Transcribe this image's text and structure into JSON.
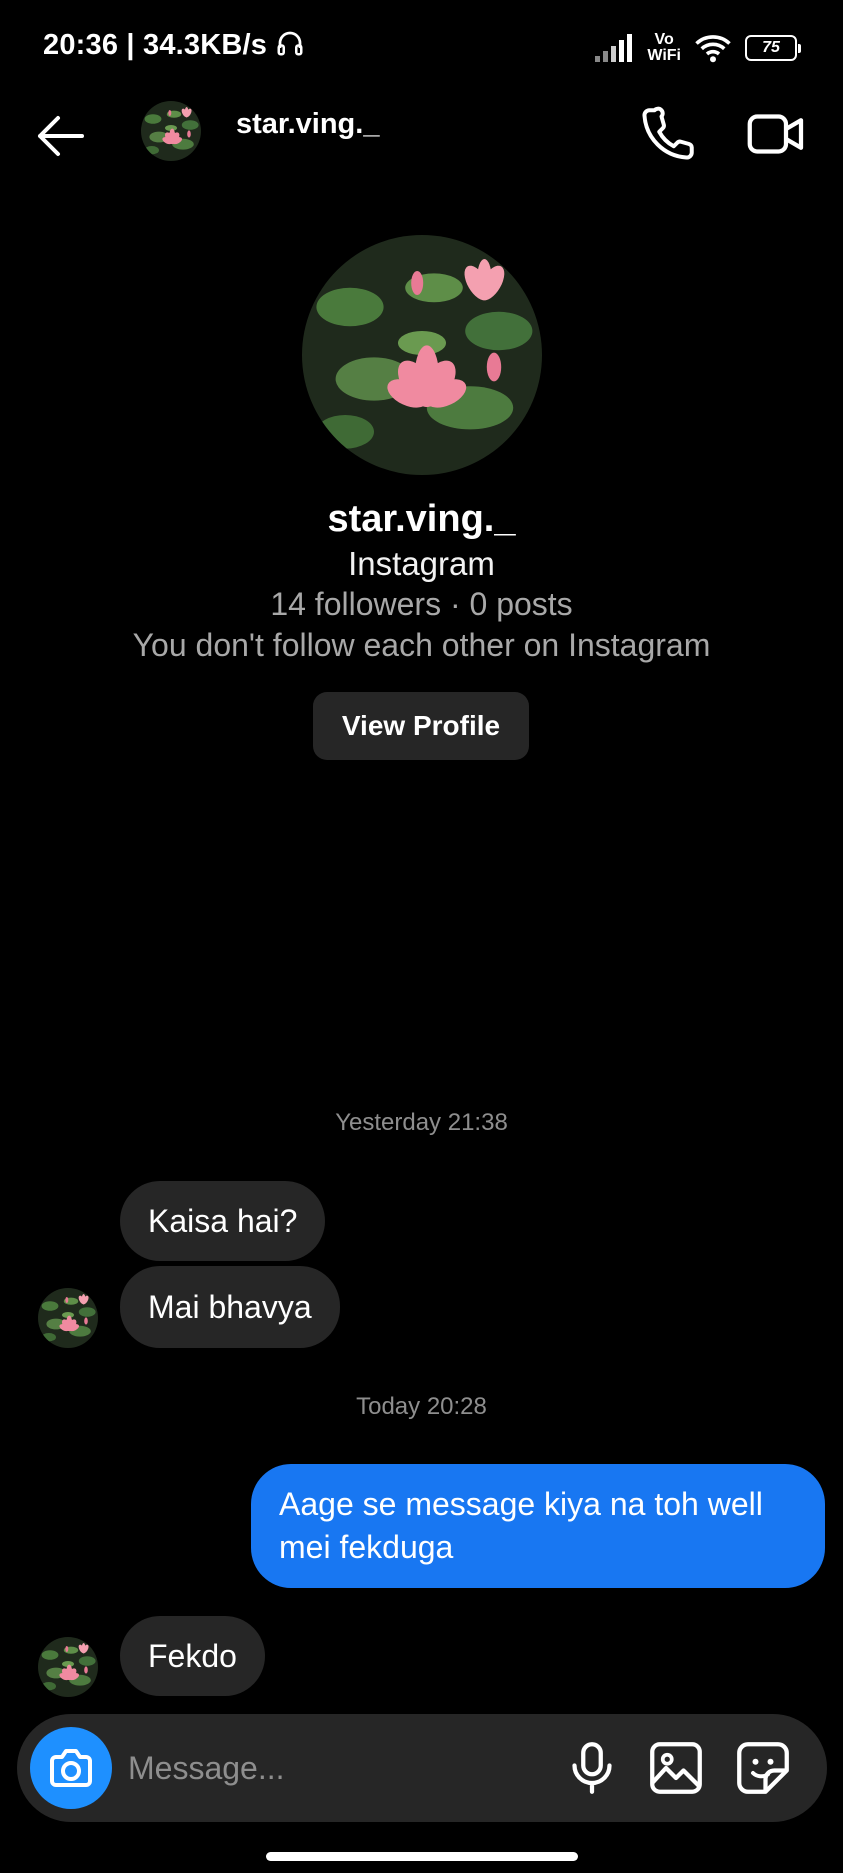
{
  "status_bar": {
    "time_speed": "20:36 | 34.3KB/s",
    "volte_top": "Vo",
    "volte_bottom": "WiFi",
    "battery": "75",
    "icons": [
      "headphones-icon",
      "signal-icon",
      "vowifi-icon",
      "wifi-icon",
      "battery-icon"
    ]
  },
  "header": {
    "username": "star.ving._",
    "icons": [
      "back-arrow-icon",
      "phone-icon",
      "video-camera-icon"
    ]
  },
  "profile": {
    "name": "star.ving._",
    "app": "Instagram",
    "stats": "14 followers · 0 posts",
    "follow_status": "You don't follow each other on Instagram",
    "view_profile_label": "View Profile"
  },
  "conversation": {
    "timestamps": [
      "Yesterday 21:38",
      "Today 20:28"
    ],
    "messages": [
      {
        "from": "them",
        "text": "Kaisa hai?"
      },
      {
        "from": "them",
        "text": "Mai bhavya"
      },
      {
        "from": "me",
        "text": "Aage se message kiya na toh well mei fekduga"
      },
      {
        "from": "them",
        "text": "Fekdo"
      }
    ]
  },
  "composer": {
    "placeholder": "Message...",
    "icons": [
      "camera-icon",
      "microphone-icon",
      "gallery-icon",
      "sticker-icon"
    ]
  },
  "colors": {
    "background": "#000000",
    "incoming_bubble": "#262626",
    "outgoing_bubble": "#1877f2",
    "camera_button": "#1e90ff",
    "secondary_text": "#a8a8a8"
  }
}
